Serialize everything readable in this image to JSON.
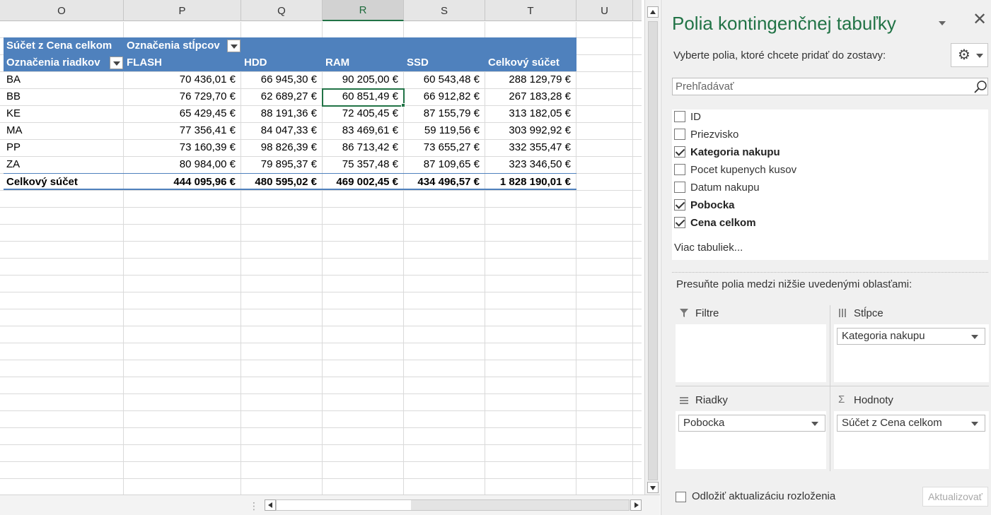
{
  "sheet": {
    "columns": [
      "O",
      "P",
      "Q",
      "R",
      "S",
      "T",
      "U"
    ],
    "active_column": "R"
  },
  "pivot": {
    "header": {
      "values_label": "Súčet z Cena celkom",
      "columns_label": "Označenia stĺpcov",
      "rows_label": "Označenia riadkov",
      "categories": [
        "FLASH",
        "HDD",
        "RAM",
        "SSD",
        "Celkový súčet"
      ]
    },
    "rows": [
      {
        "label": "BA",
        "values": [
          "70 436,01 €",
          "66 945,30 €",
          "90 205,00 €",
          "60 543,48 €",
          "288 129,79 €"
        ]
      },
      {
        "label": "BB",
        "values": [
          "76 729,70 €",
          "62 689,27 €",
          "60 851,49 €",
          "66 912,82 €",
          "267 183,28 €"
        ]
      },
      {
        "label": "KE",
        "values": [
          "65 429,45 €",
          "88 191,36 €",
          "72 405,45 €",
          "87 155,79 €",
          "313 182,05 €"
        ]
      },
      {
        "label": "MA",
        "values": [
          "77 356,41 €",
          "84 047,33 €",
          "83 469,61 €",
          "59 119,56 €",
          "303 992,92 €"
        ]
      },
      {
        "label": "PP",
        "values": [
          "73 160,39 €",
          "98 826,39 €",
          "86 713,42 €",
          "73 655,27 €",
          "332 355,47 €"
        ]
      },
      {
        "label": "ZA",
        "values": [
          "80 984,00 €",
          "79 895,37 €",
          "75 357,48 €",
          "87 109,65 €",
          "323 346,50 €"
        ]
      }
    ],
    "total": {
      "label": "Celkový súčet",
      "values": [
        "444 095,96 €",
        "480 595,02 €",
        "469 002,45 €",
        "434 496,57 €",
        "1 828 190,01 €"
      ]
    }
  },
  "panel": {
    "title": "Polia kontingenčnej tabuľky",
    "close": "✕",
    "choose_text": "Vyberte polia, ktoré chcete pridať do zostavy:",
    "search_placeholder": "Prehľadávať",
    "fields": [
      {
        "label": "ID",
        "checked": false
      },
      {
        "label": "Priezvisko",
        "checked": false
      },
      {
        "label": "Kategoria nakupu",
        "checked": true
      },
      {
        "label": "Pocet kupenych kusov",
        "checked": false
      },
      {
        "label": "Datum nakupu",
        "checked": false
      },
      {
        "label": "Pobocka",
        "checked": true
      },
      {
        "label": "Cena celkom",
        "checked": true
      }
    ],
    "more_tables": "Viac tabuliek...",
    "drag_text": "Presuňte polia medzi nižšie uvedenými oblasťami:",
    "areas": {
      "filters": {
        "label": "Filtre"
      },
      "columns": {
        "label": "Stĺpce",
        "chip": "Kategoria nakupu"
      },
      "rows": {
        "label": "Riadky",
        "chip": "Pobocka"
      },
      "values": {
        "label": "Hodnoty",
        "chip": "Súčet z Cena celkom"
      }
    },
    "defer_label": "Odložiť aktualizáciu rozloženia",
    "update_label": "Aktualizovať"
  },
  "icons": {
    "gear": "gear-icon",
    "search": "search-icon",
    "filter": "filter-icon",
    "columns": "columns-icon",
    "rows": "rows-icon",
    "sum": "sigma-icon"
  },
  "colors": {
    "pivot_header": "#4f81bd",
    "accent_green": "#217346"
  }
}
